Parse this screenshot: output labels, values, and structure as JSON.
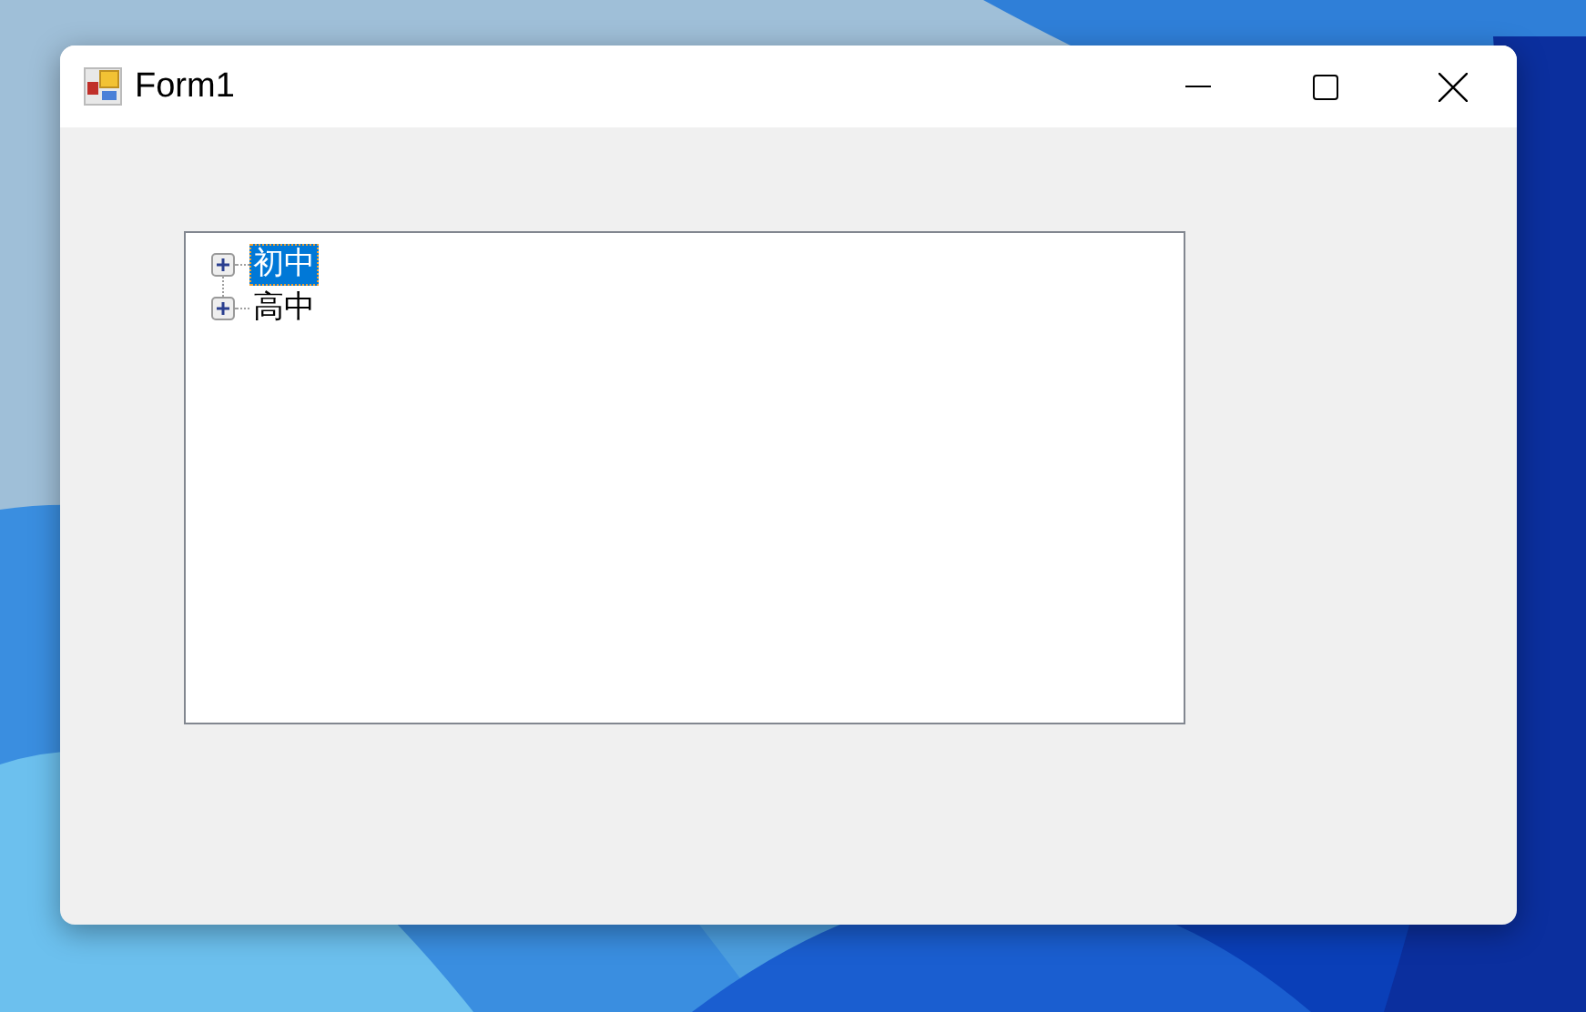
{
  "window": {
    "title": "Form1"
  },
  "tree": {
    "nodes": [
      {
        "label": "初中",
        "selected": true,
        "expanded": false
      },
      {
        "label": "高中",
        "selected": false,
        "expanded": false
      }
    ]
  }
}
